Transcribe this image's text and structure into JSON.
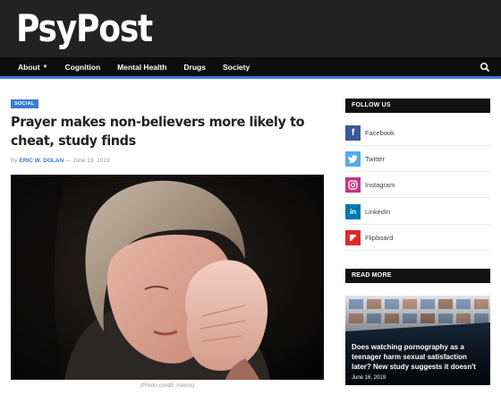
{
  "site": {
    "logo": "PsyPost"
  },
  "nav": {
    "items": [
      {
        "label": "About",
        "has_dropdown": true
      },
      {
        "label": "Cognition"
      },
      {
        "label": "Mental Health"
      },
      {
        "label": "Drugs"
      },
      {
        "label": "Society"
      }
    ],
    "search_icon": "search-icon"
  },
  "article": {
    "category": "SOCIAL",
    "title": "Prayer makes non-believers more likely to cheat, study finds",
    "byline_prefix": "By",
    "author": "ERIC W. DOLAN",
    "date": "June 13, 2019",
    "caption": "(Photo credit: memo)"
  },
  "sidebar": {
    "follow_title": "FOLLOW US",
    "social": [
      {
        "name": "Facebook",
        "icon": "facebook-icon",
        "color": "#3b5998"
      },
      {
        "name": "Twitter",
        "icon": "twitter-icon",
        "color": "#55acee"
      },
      {
        "name": "Instagram",
        "icon": "instagram-icon",
        "color": "#c13584"
      },
      {
        "name": "LinkedIn",
        "icon": "linkedin-icon",
        "color": "#0077b5"
      },
      {
        "name": "Flipboard",
        "icon": "flipboard-icon",
        "color": "#e12828"
      }
    ],
    "read_more_title": "READ MORE",
    "read_more": {
      "title": "Does watching pornography as a teenager harm sexual satisfaction later? New study suggests it doesn't",
      "date": "June 16, 2019"
    }
  },
  "colors": {
    "accent": "#3a7bd5",
    "header_bg": "#222222",
    "nav_bg": "#0d0d0d"
  }
}
